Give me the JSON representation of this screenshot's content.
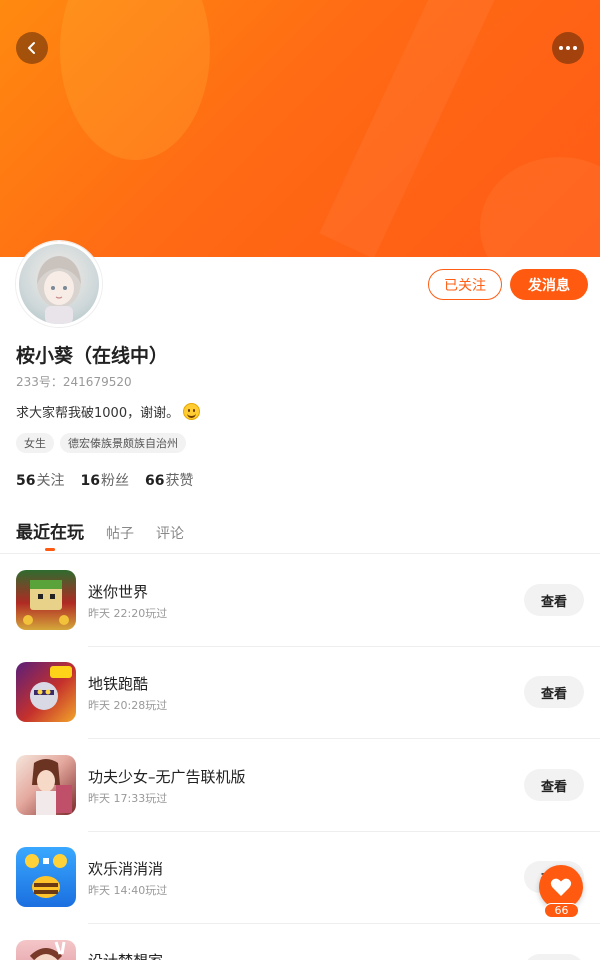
{
  "profile": {
    "name": "桉小葵（在线中）",
    "uid": "233号：241679520",
    "bio": "求大家帮我破1000，谢谢。",
    "tags": [
      "女生",
      "德宏傣族景颇族自治州"
    ],
    "stats": [
      {
        "value": "56",
        "label": "关注"
      },
      {
        "value": "16",
        "label": "粉丝"
      },
      {
        "value": "66",
        "label": "获赞"
      }
    ]
  },
  "actions": {
    "followed_label": "已关注",
    "message_label": "发消息"
  },
  "tabs": [
    {
      "label": "最近在玩",
      "active": true
    },
    {
      "label": "帖子",
      "active": false
    },
    {
      "label": "评论",
      "active": false
    }
  ],
  "games": [
    {
      "title": "迷你世界",
      "time": "昨天 22:20玩过",
      "button": "查看",
      "icon": "mini-world-icon"
    },
    {
      "title": "地铁跑酷",
      "time": "昨天 20:28玩过",
      "button": "查看",
      "icon": "subway-surfers-icon"
    },
    {
      "title": "功夫少女–无广告联机版",
      "time": "昨天 17:33玩过",
      "button": "查看",
      "icon": "kungfu-girl-icon"
    },
    {
      "title": "欢乐消消消",
      "time": "昨天 14:40玩过",
      "button": "查看",
      "icon": "happy-match-icon"
    },
    {
      "title": "设计梦想家",
      "time": "",
      "button": "查看",
      "icon": "design-dreamer-icon"
    }
  ],
  "like_fab": {
    "count": "66"
  },
  "colors": {
    "accent": "#ff5a10",
    "banner_start": "#ff8a10",
    "banner_end": "#ff5a16"
  }
}
